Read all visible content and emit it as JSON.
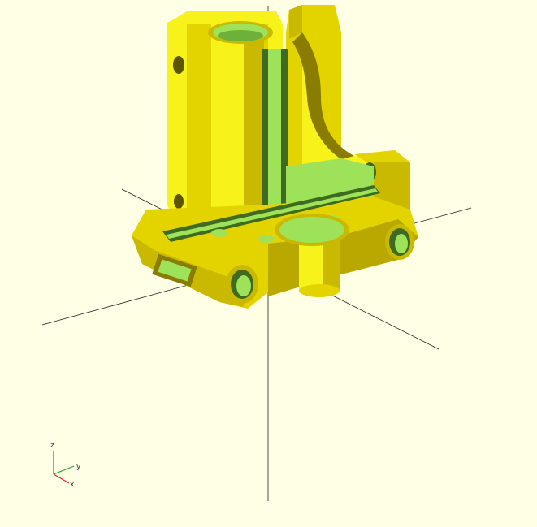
{
  "viewport": {
    "background": "#ffffe5",
    "model_colors": {
      "face_light": "#f7f21a",
      "face_mid": "#e3d400",
      "face_dark": "#b9a800",
      "shadow": "#8a7c00",
      "inner": "#9ee25a",
      "inner_dark": "#3f6b20",
      "edge": "#c9b900"
    }
  },
  "axes_indicator": {
    "labels": {
      "z": "z",
      "y": "y",
      "x": "x"
    },
    "colors": {
      "z": "#1a6fd1",
      "y": "#23a023",
      "x": "#d12a2a"
    }
  }
}
